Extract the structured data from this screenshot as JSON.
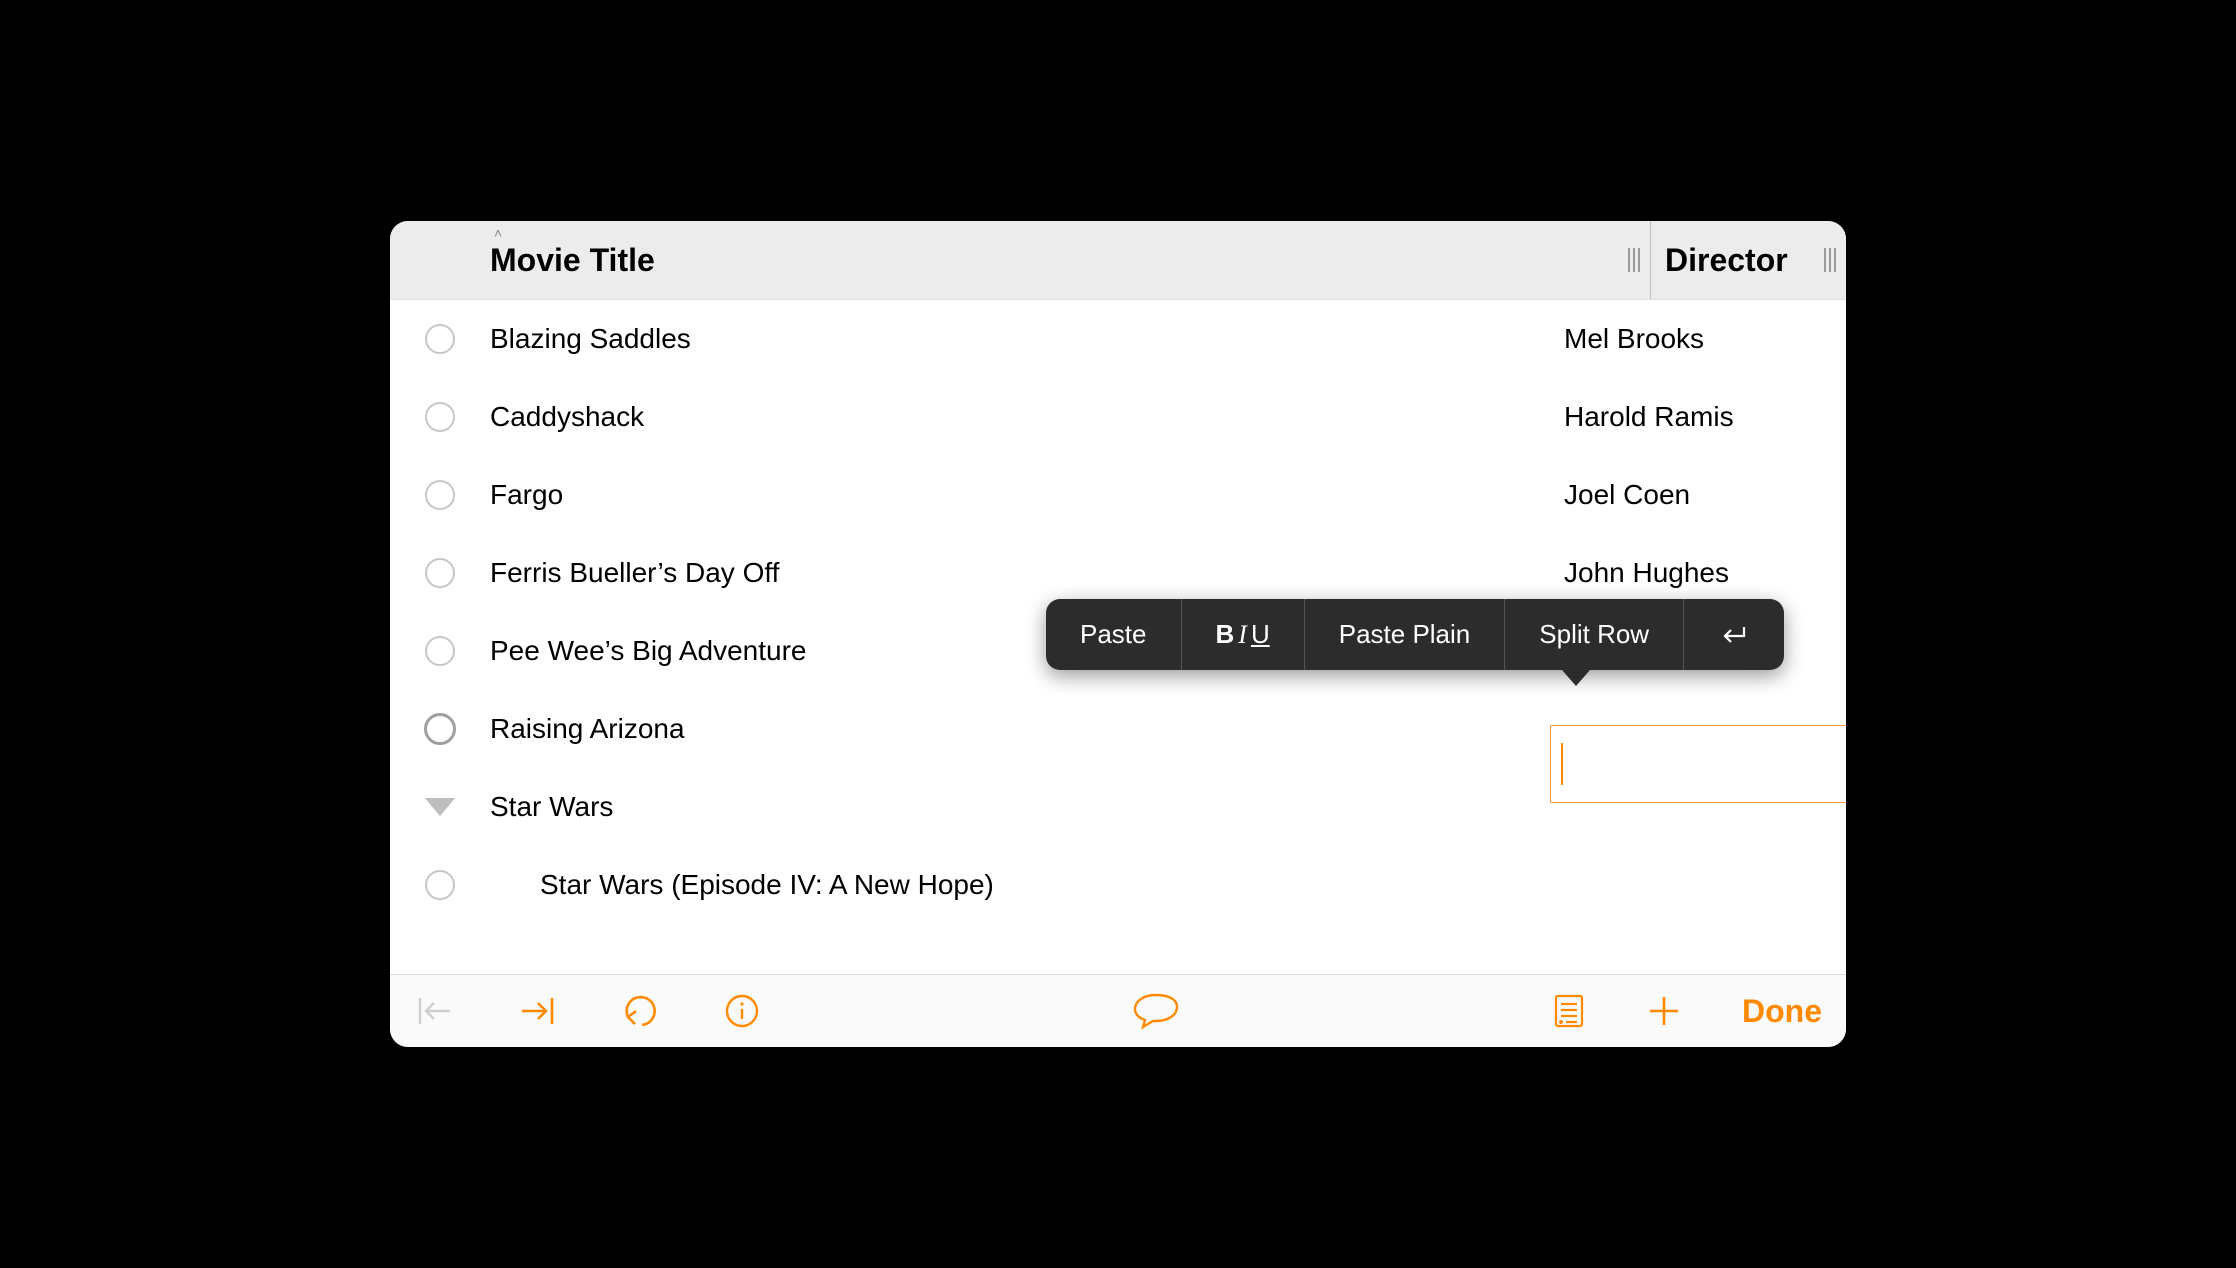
{
  "columns": {
    "col1": "Movie Title",
    "col2": "Director"
  },
  "rows": [
    {
      "title": "Blazing Saddles",
      "director": "Mel Brooks",
      "handle": "circle"
    },
    {
      "title": "Caddyshack",
      "director": "Harold Ramis",
      "handle": "circle"
    },
    {
      "title": "Fargo",
      "director": "Joel Coen",
      "handle": "circle"
    },
    {
      "title": "Ferris Bueller’s Day Off",
      "director": "John Hughes",
      "handle": "circle"
    },
    {
      "title": "Pee Wee’s Big Adventure",
      "director": "",
      "handle": "circle"
    },
    {
      "title": "Raising Arizona",
      "director": "",
      "handle": "circle-active",
      "editing": true
    },
    {
      "title": "Star Wars",
      "director": "",
      "handle": "triangle"
    },
    {
      "title": "Star Wars (Episode IV: A New Hope)",
      "director": "",
      "handle": "circle",
      "indent": true
    }
  ],
  "popover": {
    "paste": "Paste",
    "paste_plain": "Paste Plain",
    "split_row": "Split Row"
  },
  "toolbar": {
    "done": "Done"
  },
  "icons": {
    "outdent": "outdent-icon",
    "indent": "indent-icon",
    "undo": "undo-icon",
    "info": "info-icon",
    "comment": "comment-icon",
    "note": "note-icon",
    "add": "plus-icon",
    "return": "return-icon"
  },
  "colors": {
    "accent": "#ff8a00"
  }
}
